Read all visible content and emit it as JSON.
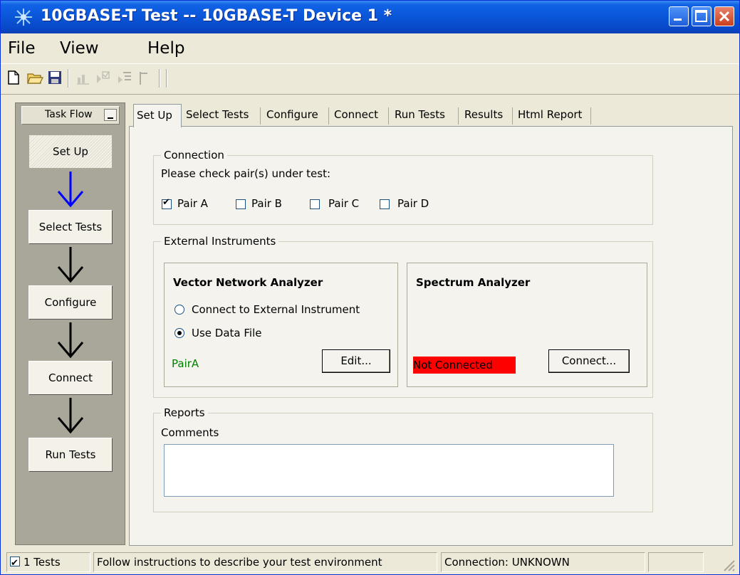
{
  "window": {
    "title": "10GBASE-T Test -- 10GBASE-T Device 1 *"
  },
  "menu": [
    "File",
    "View",
    "Help"
  ],
  "toolbar_icons": [
    "new-file-icon",
    "open-folder-icon",
    "save-icon",
    "chart-icon",
    "checkbox-run-icon",
    "list-run-icon",
    "step-icon",
    "separator-icon"
  ],
  "taskflow": {
    "header": "Task Flow",
    "steps": [
      "Set Up",
      "Select Tests",
      "Configure",
      "Connect",
      "Run Tests"
    ],
    "active_step": "Set Up",
    "active_arrow_color": "#0000FF"
  },
  "tabs": [
    "Set Up",
    "Select Tests",
    "Configure",
    "Connect",
    "Run Tests",
    "Results",
    "Html Report"
  ],
  "active_tab": "Set Up",
  "connection": {
    "legend": "Connection",
    "prompt": "Please check pair(s) under test:",
    "pairs": [
      {
        "label": "Pair A",
        "checked": true
      },
      {
        "label": "Pair B",
        "checked": false
      },
      {
        "label": "Pair C",
        "checked": false
      },
      {
        "label": "Pair D",
        "checked": false
      }
    ]
  },
  "external": {
    "legend": "External Instruments",
    "vna": {
      "title": "Vector Network Analyzer",
      "option_external": "Connect to External Instrument",
      "option_file": "Use Data File",
      "selected": "Use Data File",
      "file_label": "PairA",
      "file_label_color": "#008000",
      "edit_button": "Edit..."
    },
    "spectrum": {
      "title": "Spectrum Analyzer",
      "status": "Not Connected",
      "status_color": "#FF0000",
      "connect_button": "Connect..."
    }
  },
  "reports": {
    "legend": "Reports",
    "comments_label": "Comments",
    "comments_value": ""
  },
  "status": {
    "tests": "1 Tests",
    "tests_checked": true,
    "message": "Follow instructions to describe your test environment",
    "connection": "Connection: UNKNOWN"
  }
}
